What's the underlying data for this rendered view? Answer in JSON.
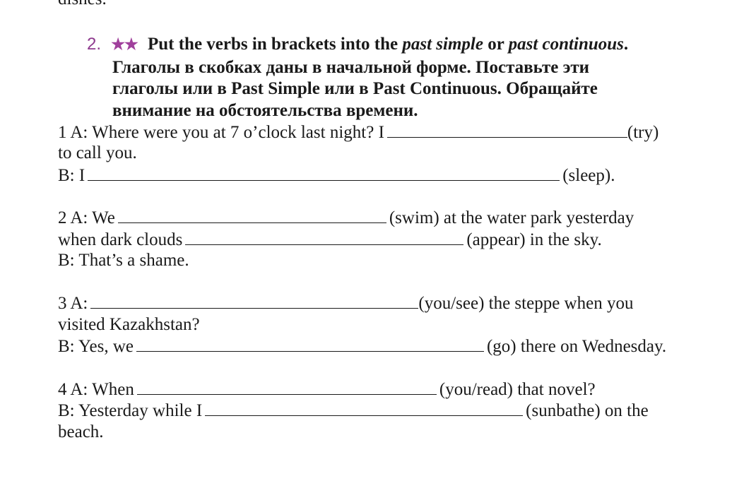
{
  "previous_exercise_tail": "dishes.",
  "exercise": {
    "number": "2.",
    "stars": "★★",
    "instruction_en": {
      "part1": "Put the verbs in brackets into the ",
      "italic1": "past simple",
      "part2": " or ",
      "italic2": "past continuous",
      "part3": "."
    },
    "instruction_ru": [
      "Глаголы в скобках даны в начальной форме. Поставьте эти",
      "глаголы или в Past Simple или в Past Continuous. Обращайте",
      "внимание на обстоятельства времени."
    ]
  },
  "items": [
    {
      "l1a": "1 A: Where were you at 7 o’clock last night? I",
      "l1b": "(try)",
      "l2": "to call you.",
      "l3a": "B: I",
      "l3b": "(sleep)."
    },
    {
      "l1a": "2 A: We",
      "l1b": "(swim) at the water park yesterday",
      "l2a": "when dark clouds",
      "l2b": "(appear) in the sky.",
      "l3": "B: That’s a shame."
    },
    {
      "l1a": "3 A:",
      "l1b": "(you/see) the steppe when you",
      "l2": "visited Kazakhstan?",
      "l3a": "B: Yes, we",
      "l3b": "(go) there on Wednesday."
    },
    {
      "l1a": "4 A: When",
      "l1b": "(you/read) that novel?",
      "l2a": "B: Yesterday while I",
      "l2b": "(sunbathe) on the",
      "l3": "beach."
    }
  ],
  "colors": {
    "accent": "#8e3a8e",
    "text": "#1a1a1a"
  }
}
